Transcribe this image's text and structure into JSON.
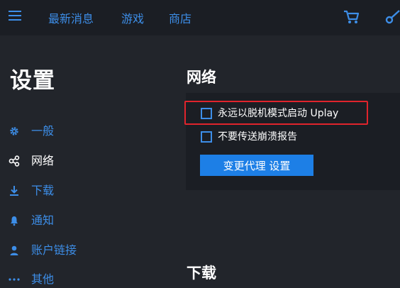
{
  "topbar": {
    "nav": [
      {
        "label": "最新消息"
      },
      {
        "label": "游戏"
      },
      {
        "label": "商店"
      }
    ],
    "icons": [
      "menu-icon",
      "cart-icon",
      "link-icon"
    ]
  },
  "page": {
    "title": "设置"
  },
  "sidebar": {
    "items": [
      {
        "label": "一般",
        "icon": "gear-icon",
        "active": false
      },
      {
        "label": "网络",
        "icon": "network-icon",
        "active": true
      },
      {
        "label": "下载",
        "icon": "download-icon",
        "active": false
      },
      {
        "label": "通知",
        "icon": "bell-icon",
        "active": false
      },
      {
        "label": "账户链接",
        "icon": "user-icon",
        "active": false
      },
      {
        "label": "其他",
        "icon": "more-icon",
        "active": false
      }
    ]
  },
  "network": {
    "title": "网络",
    "options": [
      {
        "label": "永远以脱机模式启动 Uplay",
        "checked": false,
        "highlighted": true
      },
      {
        "label": "不要传送崩溃报告",
        "checked": false,
        "highlighted": false
      }
    ],
    "proxy_button": "变更代理 设置"
  },
  "download": {
    "title": "下载"
  },
  "colors": {
    "accent": "#3d8ee8",
    "button": "#1d7fe6",
    "background": "#22252b",
    "panel": "#1b1e24",
    "highlight": "#e0242c"
  }
}
